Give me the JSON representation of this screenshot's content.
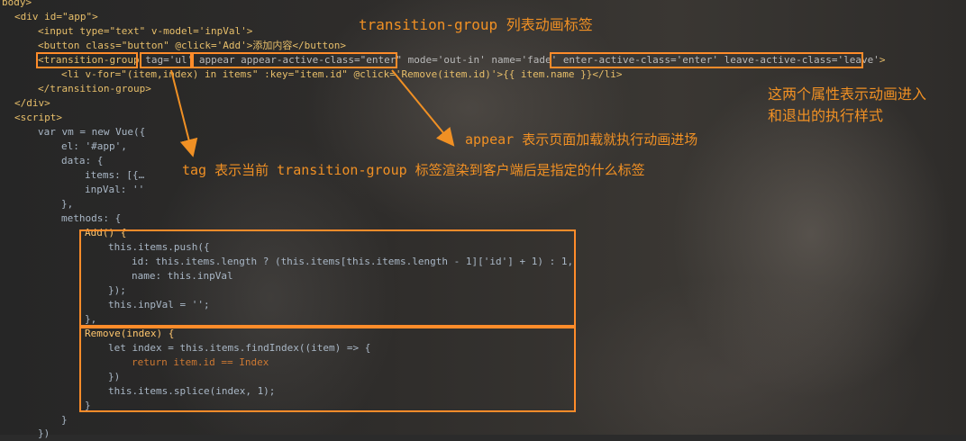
{
  "code_lines": [
    [
      "body>"
    ],
    [
      "<div id=\"app\">"
    ],
    [
      "<input type=\"text\" v-model='inpVal'>"
    ],
    [
      "<button class=\"button\" @click='Add'>添加内容</button>"
    ],
    [
      "<transition-group",
      " tag='ul'",
      " appear appear-active-class=\"enter\"",
      " mode='out-in' name='fade' ",
      "enter-active-class='enter' leave-active-class='leave'",
      ">"
    ],
    [
      "<li v-for=\"(item,index) in items\" :key=\"item.id\" @click='Remove(item.id)'>{{ item.name }}</li>"
    ],
    [
      "</transition-group>"
    ],
    [
      "</div>"
    ],
    [
      "<script>"
    ],
    [
      "var vm = new Vue({"
    ],
    [
      "el: '#app',"
    ],
    [
      "data: {"
    ],
    [
      "items: [{…"
    ],
    [
      "inpVal: ''"
    ],
    [
      "},"
    ],
    [
      "methods: {"
    ],
    [
      "Add() {"
    ],
    [
      "this.items.push({"
    ],
    [
      "id: this.items.length ? (this.items[this.items.length - 1]['id'] + 1) : 1,"
    ],
    [
      "name: this.inpVal"
    ],
    [
      "});"
    ],
    [
      "this.inpVal = '';"
    ],
    [
      "},"
    ],
    [
      "Remove(index) {"
    ],
    [
      "let index = this.items.findIndex((item) => {"
    ],
    [
      "return item.id == Index"
    ],
    [
      "})"
    ],
    [
      "this.items.splice(index, 1);"
    ],
    [
      "}"
    ],
    [
      "}"
    ],
    [
      "})"
    ]
  ],
  "annotations": {
    "title": "transition-group 列表动画标签",
    "enter_leave_line1": "这两个属性表示动画进入",
    "enter_leave_line2": "和退出的执行样式",
    "appear_note": "appear 表示页面加载就执行动画进场",
    "tag_note": "tag 表示当前 transition-group 标签渲染到客户端后是指定的什么标签"
  },
  "colors": {
    "annotation": "#f09024",
    "box_border": "#ff8c2a",
    "editor_bg": "#2b2b2b"
  }
}
